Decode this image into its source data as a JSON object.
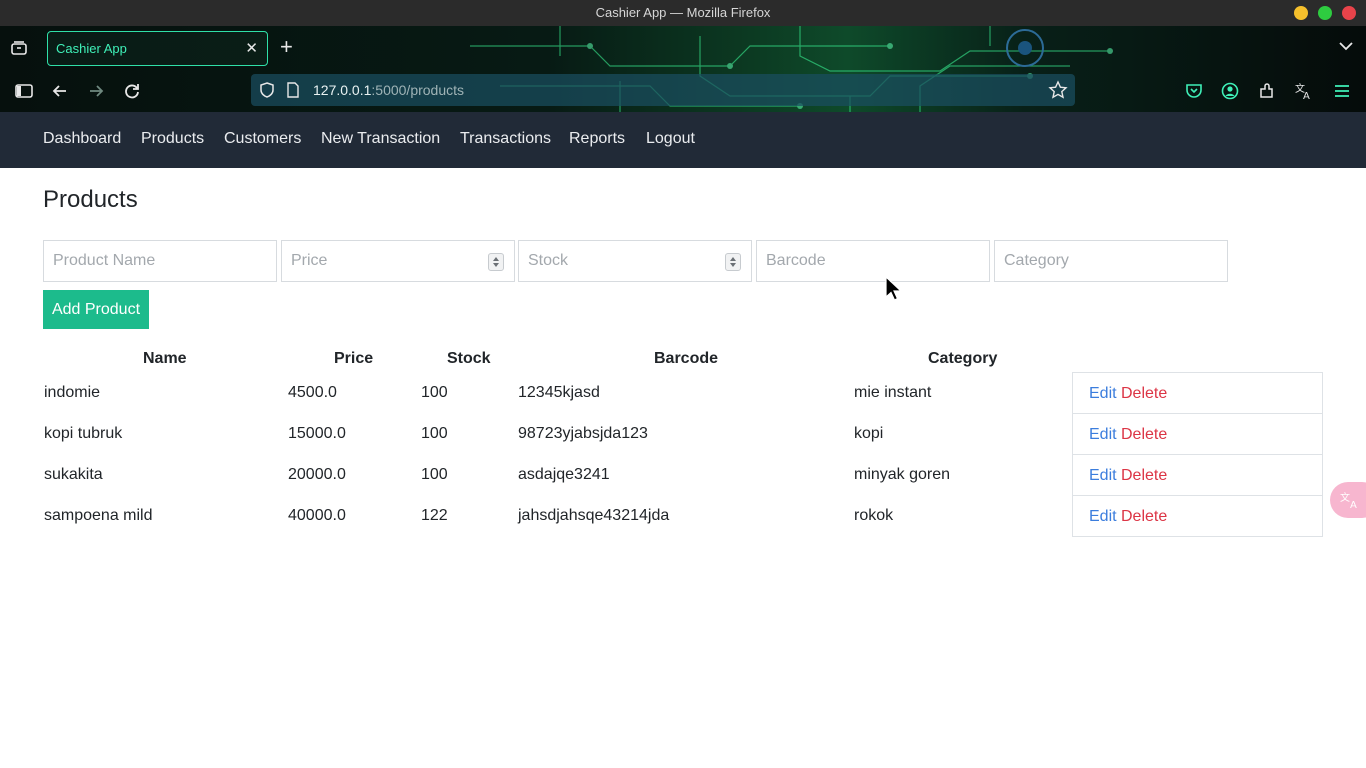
{
  "window": {
    "title": "Cashier App — Mozilla Firefox"
  },
  "browser": {
    "tab_title": "Cashier App",
    "tab_close": "✕",
    "new_tab": "+",
    "url_host": "127.0.0.1",
    "url_path": ":5000/products"
  },
  "nav": {
    "items": [
      "Dashboard",
      "Products",
      "Customers",
      "New Transaction",
      "Transactions",
      "Reports",
      "Logout"
    ]
  },
  "page": {
    "title": "Products"
  },
  "form": {
    "product_name_placeholder": "Product Name",
    "price_placeholder": "Price",
    "stock_placeholder": "Stock",
    "barcode_placeholder": "Barcode",
    "category_placeholder": "Category",
    "add_button": "Add Product"
  },
  "table": {
    "headers": [
      "Name",
      "Price",
      "Stock",
      "Barcode",
      "Category"
    ],
    "rows": [
      {
        "name": "indomie",
        "price": "4500.0",
        "stock": "100",
        "barcode": "12345kjasd",
        "category": "mie instant"
      },
      {
        "name": "kopi tubruk",
        "price": "15000.0",
        "stock": "100",
        "barcode": "98723yjabsjda123",
        "category": "kopi"
      },
      {
        "name": "sukakita",
        "price": "20000.0",
        "stock": "100",
        "barcode": "asdajqe3241",
        "category": "minyak goren"
      },
      {
        "name": "sampoena mild",
        "price": "40000.0",
        "stock": "122",
        "barcode": "jahsdjahsqe43214jda",
        "category": "rokok"
      }
    ],
    "edit_label": "Edit",
    "delete_label": "Delete"
  },
  "colors": {
    "navbar_bg": "#212a37",
    "accent_green": "#1cbb8c",
    "link_blue": "#3b7ddd",
    "danger_red": "#dc3545",
    "tab_accent": "#2fe0a8"
  },
  "icons": {
    "window_buttons": [
      "minimize-icon",
      "maximize-icon",
      "close-icon"
    ],
    "toolbar": [
      "sidebar-icon",
      "back-icon",
      "forward-icon",
      "reload-icon",
      "shield-icon",
      "page-icon",
      "bookmark-star-icon",
      "pocket-icon",
      "account-icon",
      "extensions-icon",
      "translate-icon",
      "menu-icon"
    ]
  }
}
